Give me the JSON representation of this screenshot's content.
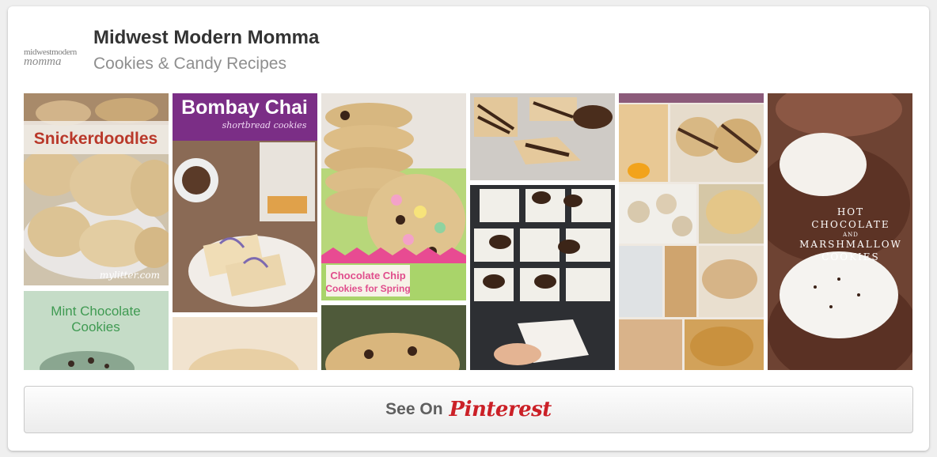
{
  "board": {
    "title": "Midwest Modern Momma",
    "subtitle": "Cookies & Candy Recipes",
    "logo": {
      "line1": "midwestmodern",
      "line2": "momma"
    }
  },
  "pins": {
    "snickerdoodles": {
      "label": "Snickerdoodles",
      "watermark": "mylitter.com"
    },
    "mint": {
      "line1": "Mint Chocolate",
      "line2": "Cookies"
    },
    "bombay": {
      "title": "Bombay Chai",
      "subtitle": "shortbread cookies"
    },
    "spring": {
      "line1": "Chocolate Chip",
      "line2": "Cookies for Spring"
    },
    "hotcocoa": {
      "line1": "HOT",
      "line2": "CHOCOLATE",
      "line3": "AND",
      "line4": "MARSHMALLOW",
      "line5": "COOKIES"
    }
  },
  "cta": {
    "see_label": "See On",
    "brand": "Pinterest"
  },
  "colors": {
    "brand_red": "#cb2027",
    "title": "#333333",
    "subtitle": "#8e8e8e"
  }
}
